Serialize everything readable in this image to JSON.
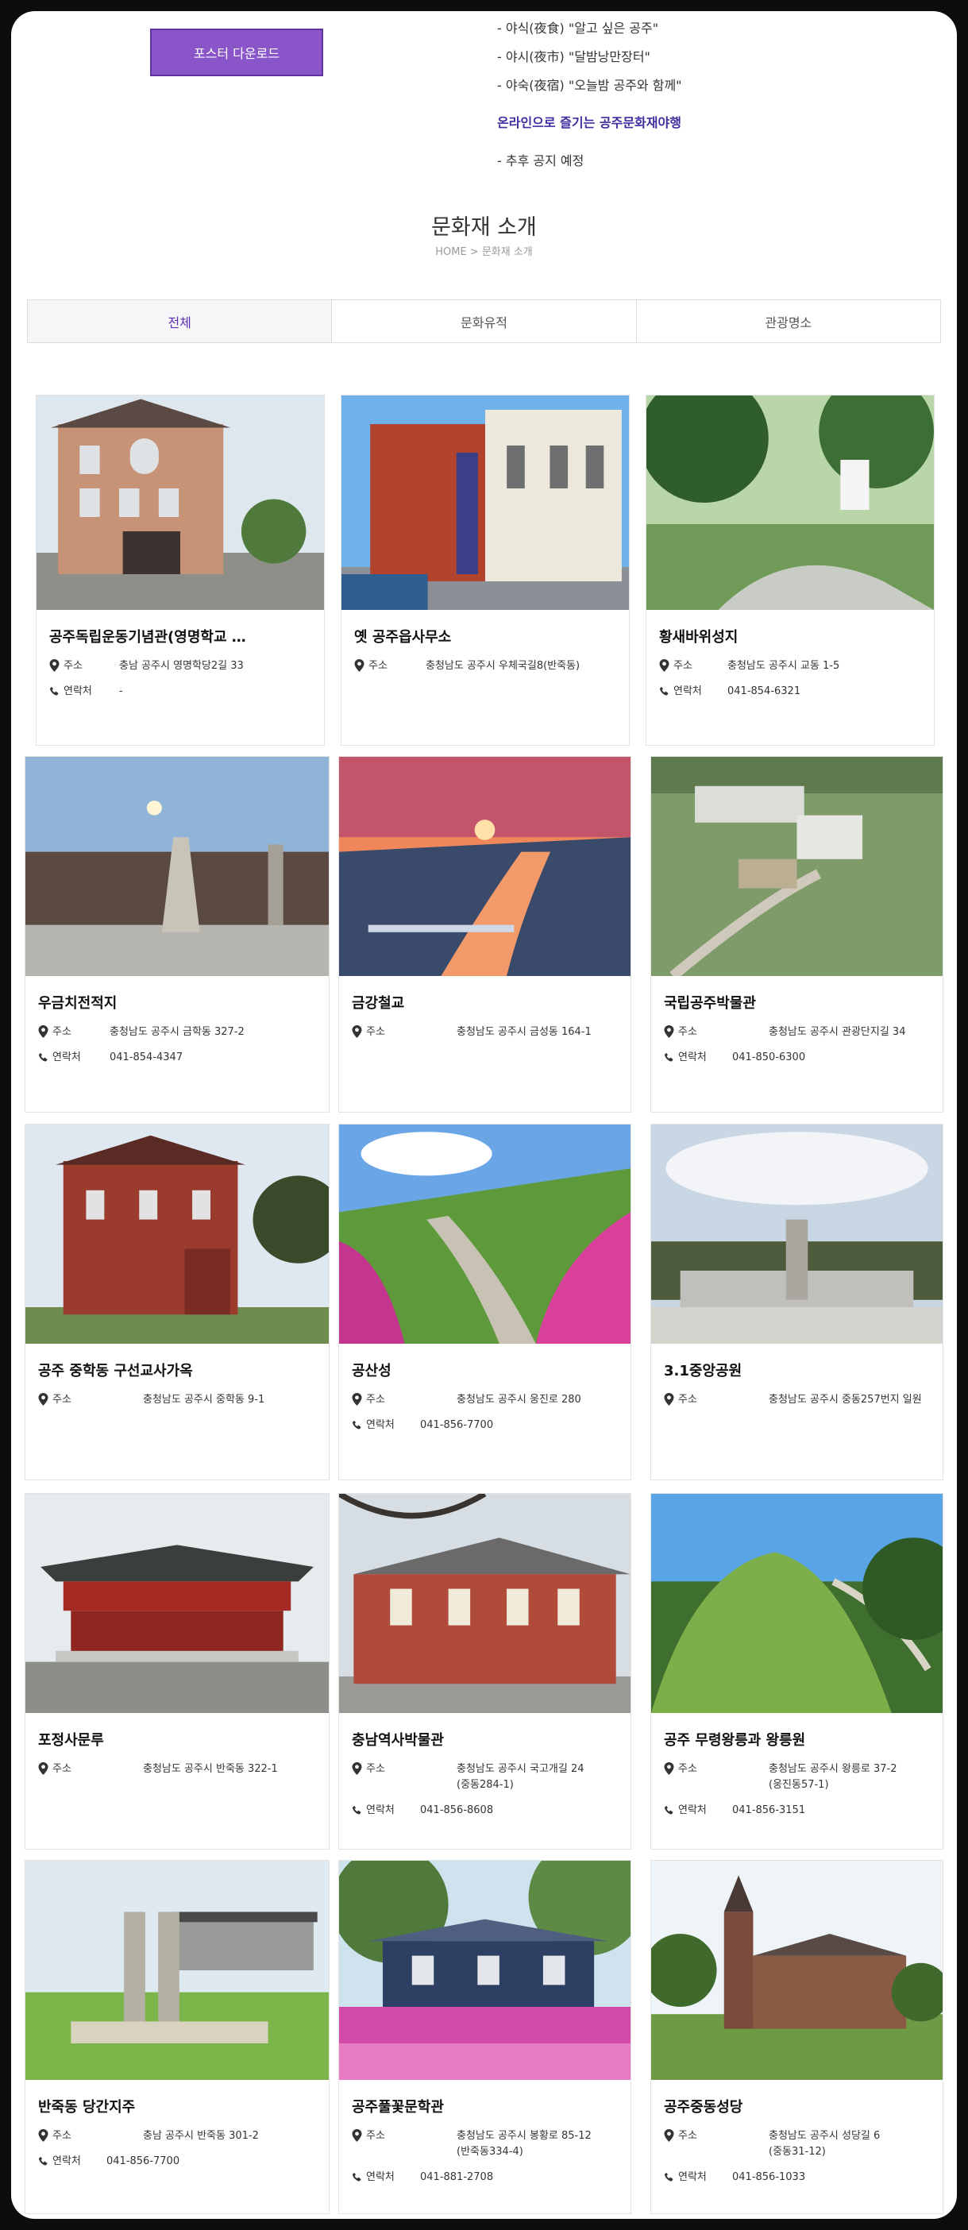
{
  "poster_button": "포스터 다운로드",
  "events": [
    "- 야식(夜食) \"알고 싶은 공주\"",
    "- 야시(夜市) \"달밤낭만장터\"",
    "- 야숙(夜宿) \"오늘밤 공주와 함께\""
  ],
  "online_link": "온라인으로 즐기는 공주문화재야행",
  "online_note": "- 추후 공지 예정",
  "section_title": "문화재 소개",
  "breadcrumb": "HOME > 문화재 소개",
  "tabs": [
    "전체",
    "문화유적",
    "관광명소"
  ],
  "active_tab": "전체",
  "label_address": "주소",
  "label_contact": "연락처",
  "colors": {
    "accent": "#8a55c9",
    "active_tab_text": "#5b2fb0",
    "online_link": "#3d2fa0"
  },
  "cards": [
    {
      "title": "공주독립운동기념관(영명학교 …",
      "address": "충남 공주시 영명학당2길 33",
      "contact": "-"
    },
    {
      "title": "옛 공주읍사무소",
      "address": "충청남도 공주시 우체국길8(반죽동)"
    },
    {
      "title": "황새바위성지",
      "address": "충청남도 공주시 교동 1-5",
      "contact": "041-854-6321"
    },
    {
      "title": "우금치전적지",
      "address": "충청남도 공주시 금학동 327-2",
      "contact": "041-854-4347"
    },
    {
      "title": "금강철교",
      "address": "충청남도 공주시 금성동 164-1"
    },
    {
      "title": "국립공주박물관",
      "address": "충청남도 공주시 관광단지길 34",
      "contact": "041-850-6300"
    },
    {
      "title": "공주 중학동 구선교사가옥",
      "address": "충청남도 공주시 중학동 9-1"
    },
    {
      "title": "공산성",
      "address": "충청남도 공주시 웅진로 280",
      "contact": "041-856-7700"
    },
    {
      "title": "3.1중앙공원",
      "address": "충청남도 공주시 중동257번지 일원"
    },
    {
      "title": "포정사문루",
      "address": "충청남도 공주시 반죽동 322-1"
    },
    {
      "title": "충남역사박물관",
      "address": "충청남도 공주시 국고개길 24",
      "address2": "(중동284-1)",
      "contact": "041-856-8608"
    },
    {
      "title": "공주 무령왕릉과 왕릉원",
      "address": "충청남도 공주시 왕릉로 37-2",
      "address2": "(웅진동57-1)",
      "contact": "041-856-3151"
    },
    {
      "title": "반죽동 당간지주",
      "address": "충남 공주시 반죽동 301-2",
      "contact": "041-856-7700"
    },
    {
      "title": "공주풀꽃문학관",
      "address": "충청남도 공주시 봉황로 85-12",
      "address2": "(반죽동334-4)",
      "contact": "041-881-2708"
    },
    {
      "title": "공주중동성당",
      "address": "충청남도 공주시 성당길 6",
      "address2": "(중동31-12)",
      "contact": "041-856-1033"
    }
  ]
}
